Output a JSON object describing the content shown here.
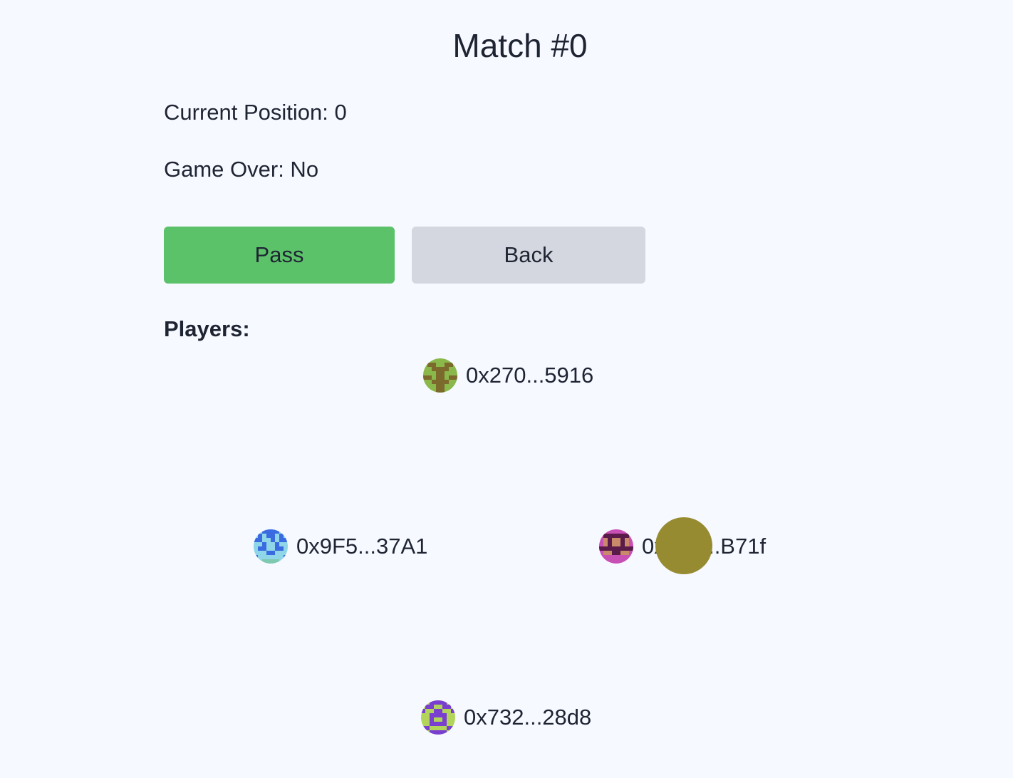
{
  "header": {
    "title": "Match #0"
  },
  "status": {
    "position_text": "Current Position: 0",
    "game_over_text": "Game Over: No"
  },
  "actions": {
    "pass_label": "Pass",
    "back_label": "Back"
  },
  "players": {
    "label": "Players:",
    "items": [
      {
        "address": "0x270...5916",
        "avatar_colors": [
          "#8ab84a",
          "#7c6a2c"
        ]
      },
      {
        "address": "0x9F5...37A1",
        "avatar_colors": [
          "#8fd6e8",
          "#3a6be0"
        ]
      },
      {
        "address": "0x817...B71f",
        "avatar_colors": [
          "#c84fb4",
          "#c98a6a",
          "#5a1a4a"
        ]
      },
      {
        "address": "0x732...28d8",
        "avatar_colors": [
          "#b2d45a",
          "#7a3fd0"
        ]
      }
    ]
  },
  "token": {
    "color": "#978b32"
  },
  "colors": {
    "background": "#f6f9ff",
    "pass_button": "#5cc26a",
    "back_button": "#d4d7df",
    "text": "#1f2433"
  }
}
